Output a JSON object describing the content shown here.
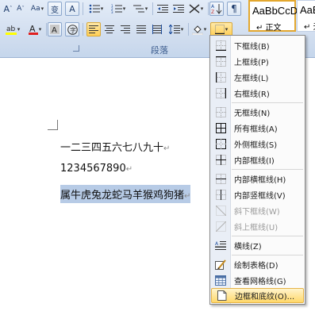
{
  "ribbon": {
    "font_row1": [
      "A",
      "A",
      "Aa",
      "变",
      "A"
    ],
    "group_label": "段落",
    "style_gallery": [
      {
        "preview": "AaBbCcD",
        "name": "↵ 正文"
      },
      {
        "preview": "AaB",
        "name": "↵ 无"
      }
    ],
    "colors": {
      "highlight": "#ffff00",
      "font_color": "#e02020",
      "ribbon_bg": "#cfdcee"
    }
  },
  "document": {
    "line1": "一二三四五六七八九十",
    "line2": "1234567890",
    "line3": "属牛虎兔龙蛇马羊猴鸡狗猪",
    "para_mark": "↵"
  },
  "border_menu": {
    "items": [
      {
        "label": "下框线(B)",
        "icon": "bottom-border-icon",
        "disabled": false
      },
      {
        "label": "上框线(P)",
        "icon": "top-border-icon",
        "disabled": false
      },
      {
        "label": "左框线(L)",
        "icon": "left-border-icon",
        "disabled": false
      },
      {
        "label": "右框线(R)",
        "icon": "right-border-icon",
        "disabled": false
      },
      {
        "label": "无框线(N)",
        "icon": "no-border-icon",
        "disabled": false
      },
      {
        "label": "所有框线(A)",
        "icon": "all-borders-icon",
        "disabled": false
      },
      {
        "label": "外侧框线(S)",
        "icon": "outside-borders-icon",
        "disabled": false
      },
      {
        "label": "内部框线(I)",
        "icon": "inside-borders-icon",
        "disabled": false
      },
      {
        "label": "内部横框线(H)",
        "icon": "inside-horizontal-border-icon",
        "disabled": false
      },
      {
        "label": "内部竖框线(V)",
        "icon": "inside-vertical-border-icon",
        "disabled": false
      },
      {
        "label": "斜下框线(W)",
        "icon": "diagonal-down-border-icon",
        "disabled": true
      },
      {
        "label": "斜上框线(U)",
        "icon": "diagonal-up-border-icon",
        "disabled": true
      },
      {
        "label": "横线(Z)",
        "icon": "horizontal-line-icon",
        "disabled": false
      },
      {
        "label": "绘制表格(D)",
        "icon": "draw-table-icon",
        "disabled": false
      },
      {
        "label": "查看网格线(G)",
        "icon": "view-gridlines-icon",
        "disabled": false
      },
      {
        "label": "边框和底纹(O)...",
        "icon": "borders-and-shading-icon",
        "disabled": false
      }
    ]
  }
}
